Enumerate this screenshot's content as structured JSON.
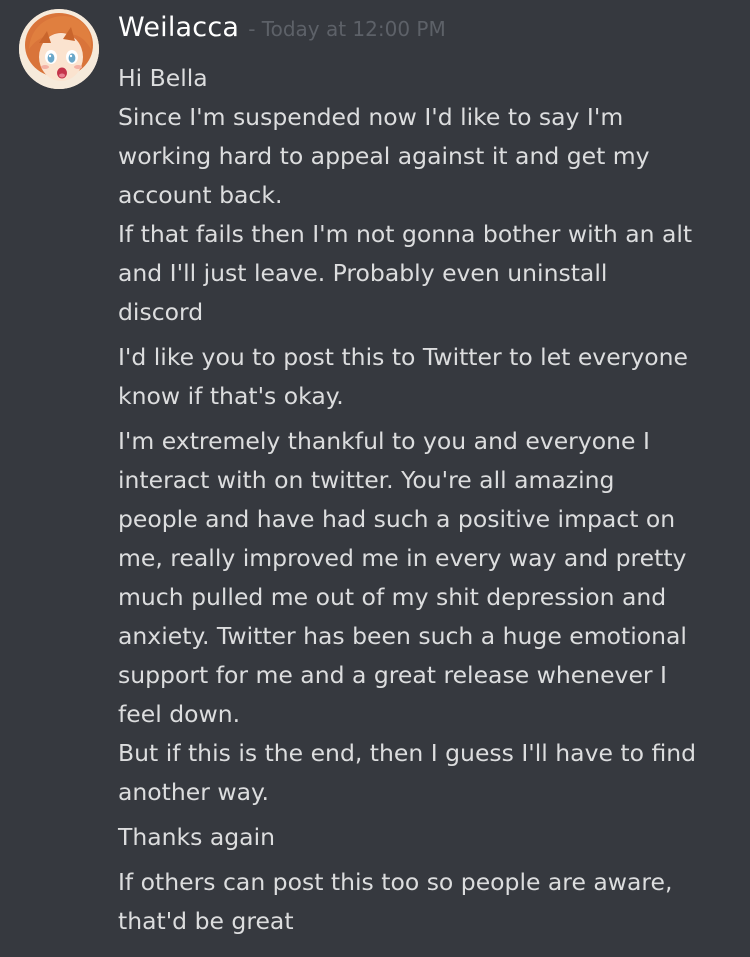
{
  "message": {
    "username": "Weilacca",
    "timestamp": "- Today at 12:00 PM",
    "avatar_icon": "anime-avatar-icon",
    "colors": {
      "background": "#36393f",
      "username": "#ffffff",
      "timestamp": "#5d6168",
      "text": "#dcddde"
    },
    "groups": [
      {
        "lines": [
          "Hi Bella",
          "Since I'm suspended now I'd like to say I'm",
          "working hard to appeal against it and get my",
          "account back.",
          "If that fails then I'm not gonna bother with an alt",
          "and I'll just leave. Probably even uninstall",
          "discord"
        ]
      },
      {
        "lines": [
          "I'd like you to post this to Twitter to let everyone",
          "know if that's okay."
        ]
      },
      {
        "lines": [
          "I'm extremely thankful to you and everyone I",
          "interact with on twitter. You're all amazing",
          "people and have had such a positive impact on",
          "me, really improved me in every way and pretty",
          "much pulled me out of my shit depression and",
          "anxiety. Twitter has been such a huge emotional",
          "support for me and a great release whenever I",
          "feel down.",
          "But if this is the end, then I guess I'll have to find",
          "another way."
        ]
      },
      {
        "lines": [
          "Thanks again"
        ]
      },
      {
        "lines": [
          "If others can post this too so people are aware,",
          "that'd be great"
        ]
      }
    ]
  }
}
